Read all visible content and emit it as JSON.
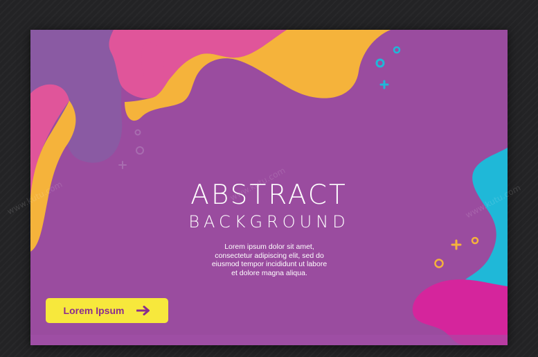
{
  "headline": "ABSTRACT",
  "subheadline": "BACKGROUND",
  "body_lines": [
    "Lorem ipsum dolor sit amet,",
    "consectetur adipiscing elit, sed do",
    "eiusmod tempor incididunt ut labore",
    "et dolore magna aliqua."
  ],
  "cta": {
    "label": "Lorem Ipsum",
    "icon": "arrow-right-icon"
  },
  "watermark": "www.kutu.com",
  "colors": {
    "backdrop": "#232325",
    "card_background": "#9a4c9f",
    "accent_yellow": "#f5b33b",
    "accent_pink": "#e0559a",
    "accent_magenta": "#d5259c",
    "accent_cyan": "#1fb8d8",
    "accent_violet": "#8a5aa3",
    "button_background": "#f7e83c",
    "button_text": "#8a2d8e"
  }
}
